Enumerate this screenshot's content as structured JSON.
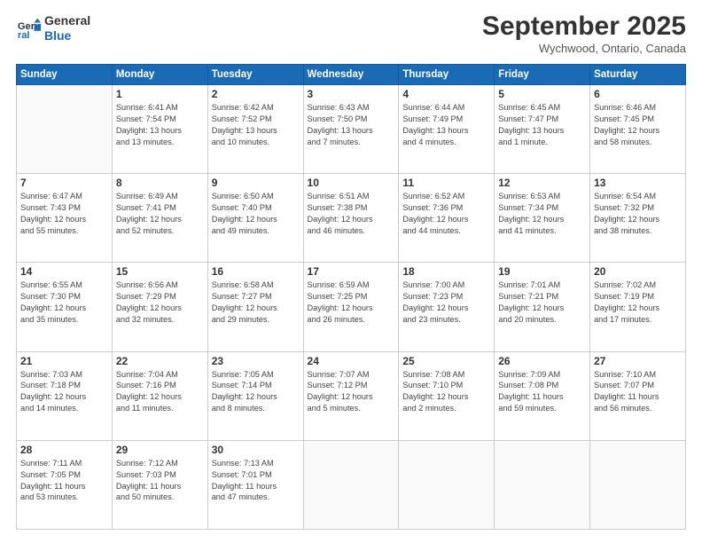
{
  "header": {
    "logo_line1": "General",
    "logo_line2": "Blue",
    "month": "September 2025",
    "location": "Wychwood, Ontario, Canada"
  },
  "days_of_week": [
    "Sunday",
    "Monday",
    "Tuesday",
    "Wednesday",
    "Thursday",
    "Friday",
    "Saturday"
  ],
  "weeks": [
    [
      {
        "day": "",
        "info": ""
      },
      {
        "day": "1",
        "info": "Sunrise: 6:41 AM\nSunset: 7:54 PM\nDaylight: 13 hours\nand 13 minutes."
      },
      {
        "day": "2",
        "info": "Sunrise: 6:42 AM\nSunset: 7:52 PM\nDaylight: 13 hours\nand 10 minutes."
      },
      {
        "day": "3",
        "info": "Sunrise: 6:43 AM\nSunset: 7:50 PM\nDaylight: 13 hours\nand 7 minutes."
      },
      {
        "day": "4",
        "info": "Sunrise: 6:44 AM\nSunset: 7:49 PM\nDaylight: 13 hours\nand 4 minutes."
      },
      {
        "day": "5",
        "info": "Sunrise: 6:45 AM\nSunset: 7:47 PM\nDaylight: 13 hours\nand 1 minute."
      },
      {
        "day": "6",
        "info": "Sunrise: 6:46 AM\nSunset: 7:45 PM\nDaylight: 12 hours\nand 58 minutes."
      }
    ],
    [
      {
        "day": "7",
        "info": "Sunrise: 6:47 AM\nSunset: 7:43 PM\nDaylight: 12 hours\nand 55 minutes."
      },
      {
        "day": "8",
        "info": "Sunrise: 6:49 AM\nSunset: 7:41 PM\nDaylight: 12 hours\nand 52 minutes."
      },
      {
        "day": "9",
        "info": "Sunrise: 6:50 AM\nSunset: 7:40 PM\nDaylight: 12 hours\nand 49 minutes."
      },
      {
        "day": "10",
        "info": "Sunrise: 6:51 AM\nSunset: 7:38 PM\nDaylight: 12 hours\nand 46 minutes."
      },
      {
        "day": "11",
        "info": "Sunrise: 6:52 AM\nSunset: 7:36 PM\nDaylight: 12 hours\nand 44 minutes."
      },
      {
        "day": "12",
        "info": "Sunrise: 6:53 AM\nSunset: 7:34 PM\nDaylight: 12 hours\nand 41 minutes."
      },
      {
        "day": "13",
        "info": "Sunrise: 6:54 AM\nSunset: 7:32 PM\nDaylight: 12 hours\nand 38 minutes."
      }
    ],
    [
      {
        "day": "14",
        "info": "Sunrise: 6:55 AM\nSunset: 7:30 PM\nDaylight: 12 hours\nand 35 minutes."
      },
      {
        "day": "15",
        "info": "Sunrise: 6:56 AM\nSunset: 7:29 PM\nDaylight: 12 hours\nand 32 minutes."
      },
      {
        "day": "16",
        "info": "Sunrise: 6:58 AM\nSunset: 7:27 PM\nDaylight: 12 hours\nand 29 minutes."
      },
      {
        "day": "17",
        "info": "Sunrise: 6:59 AM\nSunset: 7:25 PM\nDaylight: 12 hours\nand 26 minutes."
      },
      {
        "day": "18",
        "info": "Sunrise: 7:00 AM\nSunset: 7:23 PM\nDaylight: 12 hours\nand 23 minutes."
      },
      {
        "day": "19",
        "info": "Sunrise: 7:01 AM\nSunset: 7:21 PM\nDaylight: 12 hours\nand 20 minutes."
      },
      {
        "day": "20",
        "info": "Sunrise: 7:02 AM\nSunset: 7:19 PM\nDaylight: 12 hours\nand 17 minutes."
      }
    ],
    [
      {
        "day": "21",
        "info": "Sunrise: 7:03 AM\nSunset: 7:18 PM\nDaylight: 12 hours\nand 14 minutes."
      },
      {
        "day": "22",
        "info": "Sunrise: 7:04 AM\nSunset: 7:16 PM\nDaylight: 12 hours\nand 11 minutes."
      },
      {
        "day": "23",
        "info": "Sunrise: 7:05 AM\nSunset: 7:14 PM\nDaylight: 12 hours\nand 8 minutes."
      },
      {
        "day": "24",
        "info": "Sunrise: 7:07 AM\nSunset: 7:12 PM\nDaylight: 12 hours\nand 5 minutes."
      },
      {
        "day": "25",
        "info": "Sunrise: 7:08 AM\nSunset: 7:10 PM\nDaylight: 12 hours\nand 2 minutes."
      },
      {
        "day": "26",
        "info": "Sunrise: 7:09 AM\nSunset: 7:08 PM\nDaylight: 11 hours\nand 59 minutes."
      },
      {
        "day": "27",
        "info": "Sunrise: 7:10 AM\nSunset: 7:07 PM\nDaylight: 11 hours\nand 56 minutes."
      }
    ],
    [
      {
        "day": "28",
        "info": "Sunrise: 7:11 AM\nSunset: 7:05 PM\nDaylight: 11 hours\nand 53 minutes."
      },
      {
        "day": "29",
        "info": "Sunrise: 7:12 AM\nSunset: 7:03 PM\nDaylight: 11 hours\nand 50 minutes."
      },
      {
        "day": "30",
        "info": "Sunrise: 7:13 AM\nSunset: 7:01 PM\nDaylight: 11 hours\nand 47 minutes."
      },
      {
        "day": "",
        "info": ""
      },
      {
        "day": "",
        "info": ""
      },
      {
        "day": "",
        "info": ""
      },
      {
        "day": "",
        "info": ""
      }
    ]
  ]
}
